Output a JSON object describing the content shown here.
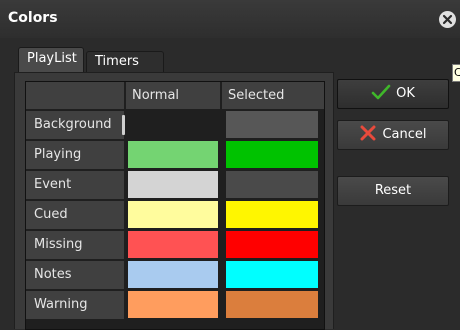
{
  "window": {
    "title": "Colors"
  },
  "tabs": [
    {
      "label": "PlayList",
      "active": true
    },
    {
      "label": "Timers",
      "active": false
    }
  ],
  "table": {
    "columns": [
      "Normal",
      "Selected"
    ],
    "rows": [
      {
        "label": "Background",
        "normal": "#1f1f1f",
        "selected": "#575757"
      },
      {
        "label": "Playing",
        "normal": "#74d472",
        "selected": "#00c200"
      },
      {
        "label": "Event",
        "normal": "#d4d4d4",
        "selected": "#4a4a4a"
      },
      {
        "label": "Cued",
        "normal": "#fffc9d",
        "selected": "#fff600"
      },
      {
        "label": "Missing",
        "normal": "#ff5253",
        "selected": "#ff0000"
      },
      {
        "label": "Notes",
        "normal": "#a9cbef",
        "selected": "#00ffff"
      },
      {
        "label": "Warning",
        "normal": "#ff9d5e",
        "selected": "#db7e3d"
      }
    ]
  },
  "buttons": {
    "ok_label": "OK",
    "cancel_label": "Cancel",
    "reset_label": "Reset"
  },
  "tooltip": {
    "text": "C"
  },
  "icons": {
    "close": "close-icon",
    "ok": "checkmark-icon",
    "cancel": "x-icon"
  },
  "colors": {
    "checkmark": "#3fb72a",
    "cancel_x": "#e84a3c"
  }
}
